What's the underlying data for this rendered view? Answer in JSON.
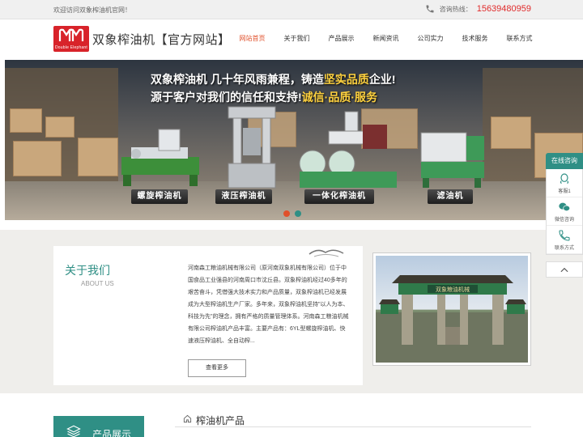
{
  "topbar": {
    "welcome": "欢迎访问双象榨油机官网！",
    "hotline_label": "咨询热线：",
    "hotline_number": "15639480959"
  },
  "header": {
    "logo_text": "Double Elephant",
    "site_title": "双象榨油机【官方网站】",
    "nav": [
      {
        "label": "网站首页",
        "active": true
      },
      {
        "label": "关于我们",
        "active": false
      },
      {
        "label": "产品展示",
        "active": false
      },
      {
        "label": "新闻资讯",
        "active": false
      },
      {
        "label": "公司实力",
        "active": false
      },
      {
        "label": "技术服务",
        "active": false
      },
      {
        "label": "联系方式",
        "active": false
      }
    ]
  },
  "banner": {
    "headline_main": "双象榨油机 几十年风雨兼程，铸造",
    "headline_highlight": "坚实品质",
    "headline_end": "企业!",
    "subline_main": "源于客户对我们的信任和支持!",
    "subline_highlight": "诚信·品质·服务",
    "captions": [
      "螺旋榨油机",
      "液压榨油机",
      "一体化榨油机",
      "滤油机"
    ],
    "dot_colors": [
      "#e0502b",
      "#2f8f85"
    ]
  },
  "about": {
    "title": "关于我们",
    "title_en": "ABOUT US",
    "text": "河南森工粮油机械有限公司（原河南双象机械有限公司）位于中国食品工业强县的河南周口市沈丘县。双象榨油机经过40多年的艰苦奋斗，凭借强大技术实力和产品质量，双象榨油机已经发展成为大型榨油机生产厂家。多年来，双象榨油机坚持\"以人为本、科技为先\"的理念，拥有严格的质量管理体系。河南森工粮油机械有限公司榨油机产品丰富。主要产品有：6YL型螺旋榨油机、快速液压榨油机、全自动榨...",
    "more_button": "查看更多",
    "gate_sign": "双象粮油机械"
  },
  "products": {
    "box_label": "产品展示",
    "heading": "榨油机产品"
  },
  "service": {
    "title": "在线咨询",
    "items": [
      {
        "label": "客服1",
        "icon": "qq-icon"
      },
      {
        "label": "微信咨询",
        "icon": "wechat-icon"
      },
      {
        "label": "联系方式",
        "icon": "phone-icon"
      }
    ]
  },
  "colors": {
    "accent": "#2f8f85",
    "nav_active": "#e0502b",
    "hotline": "#e02b2b",
    "logo": "#d8232a"
  }
}
